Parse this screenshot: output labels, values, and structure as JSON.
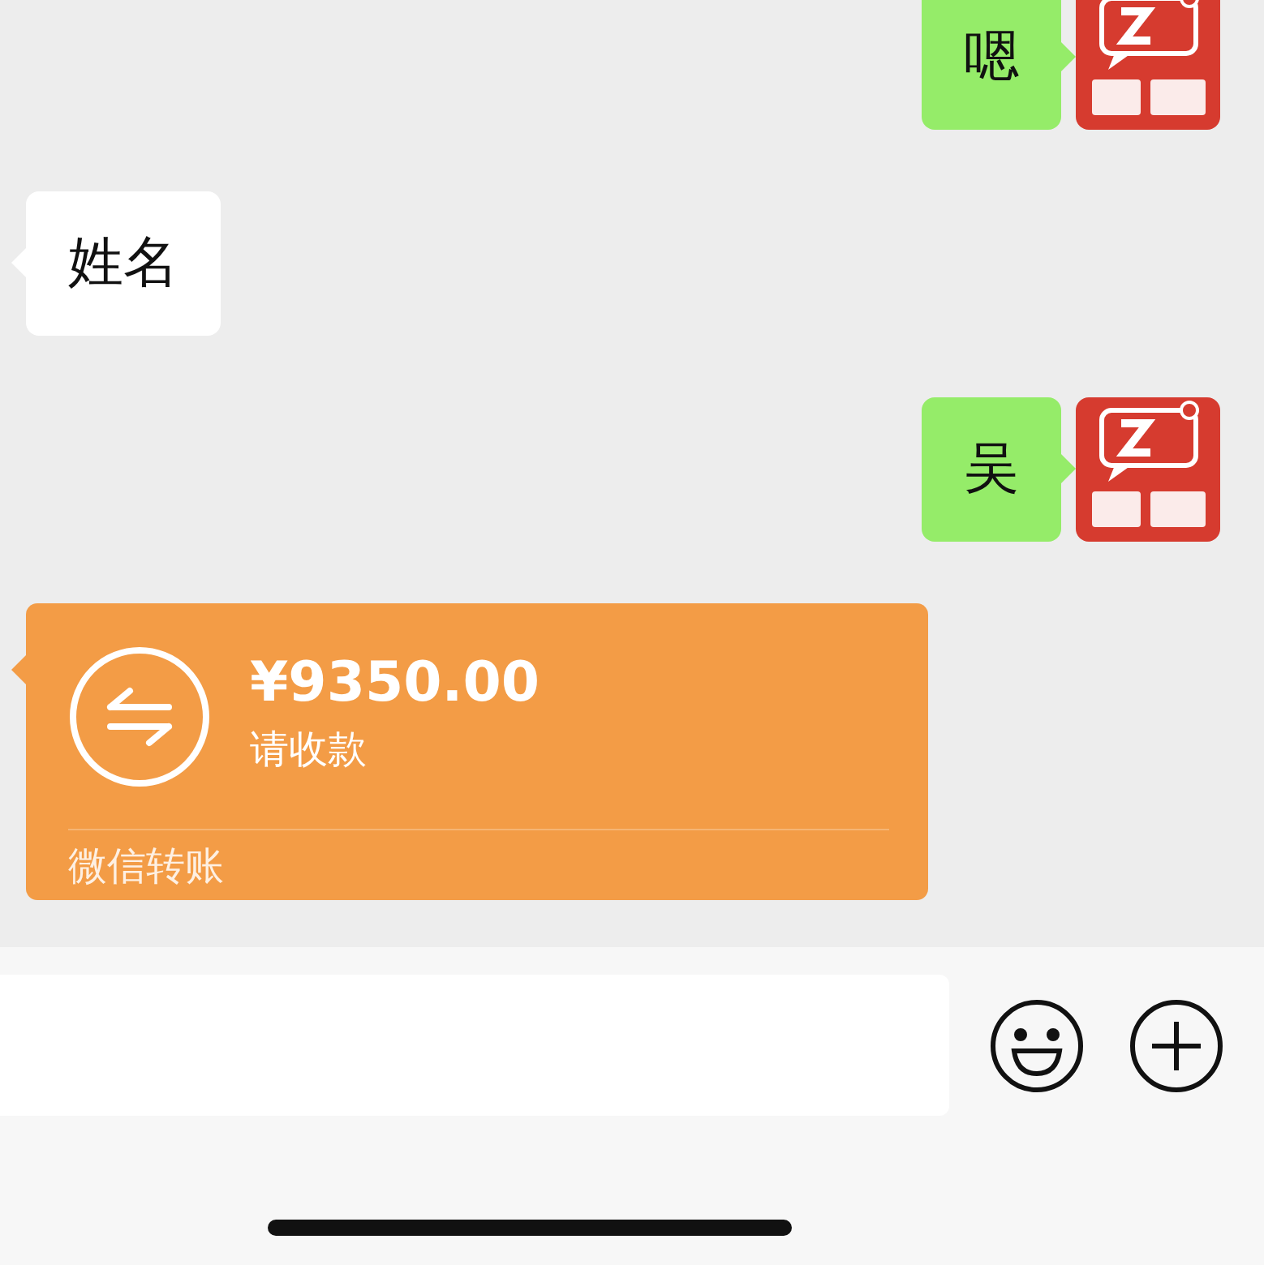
{
  "messages": [
    {
      "kind": "text",
      "outgoing": true,
      "text": "嗯"
    },
    {
      "kind": "text",
      "outgoing": false,
      "text": "姓名"
    },
    {
      "kind": "text",
      "outgoing": true,
      "text": "吴"
    },
    {
      "kind": "transfer",
      "outgoing": false,
      "amount": "¥9350.00",
      "note": "请收款",
      "footer": "微信转账"
    }
  ]
}
